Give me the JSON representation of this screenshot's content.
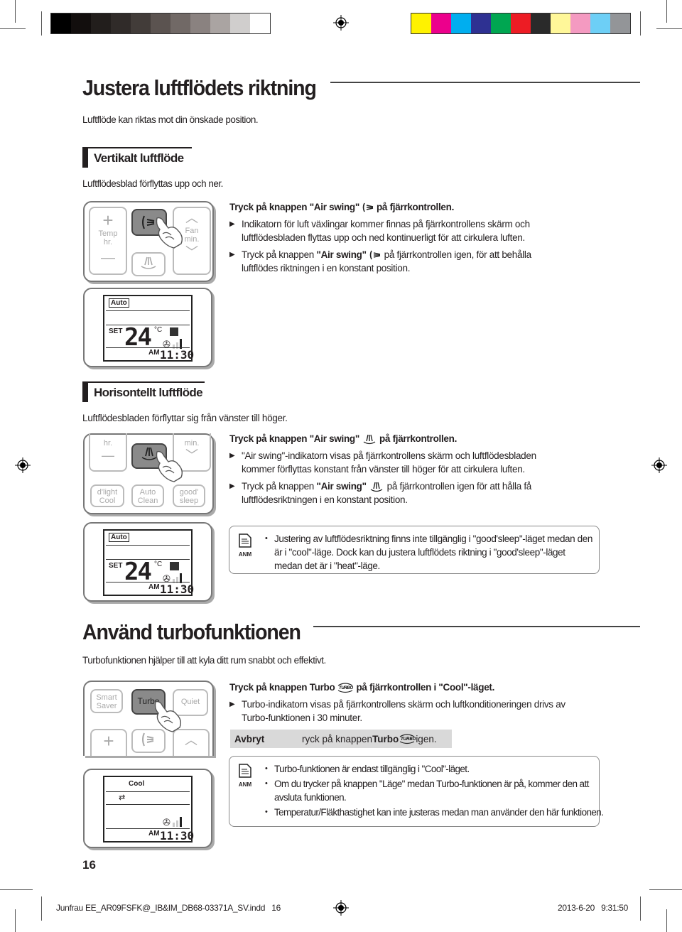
{
  "print_marks": {
    "gray_swatches": [
      "#000000",
      "#120e0d",
      "#221e1c",
      "#302b29",
      "#423c39",
      "#5b5350",
      "#716966",
      "#8a8280",
      "#aaa4a2",
      "#d0cecd",
      "#ffffff"
    ],
    "color_swatches": [
      "#fff200",
      "#ec008c",
      "#00aeef",
      "#2e3192",
      "#00a651",
      "#ed1c24",
      "#2a2a2a",
      "#fff799",
      "#f49ac1",
      "#6dcff6",
      "#939598"
    ]
  },
  "section1": {
    "title": "Justera luftflödets riktning",
    "intro": "Luftflöde kan riktas mot din önskade position.",
    "vertical": {
      "heading": "Vertikalt luftflöde",
      "subtitle": "Luftflödesblad förflyttas upp och ner.",
      "remote": {
        "left_labels": [
          "Temp",
          "hr."
        ],
        "right_labels": [
          "Fan",
          "min."
        ],
        "pressed_button_icon": "air-swing-vertical"
      },
      "lead_pre": "Tryck på knappen \"Air swing\"",
      "lead_post": "på fjärrkontrollen.",
      "bullet1": "Indikatorn för luft växlingar kommer finnas på fjärrkontrollens skärm och luftflödesbladen flyttas upp och ned kontinuerligt för att cirkulera luften.",
      "bullet2_pre": "Tryck på knappen ",
      "bullet2_bold": "\"Air swing\"",
      "bullet2_post": "på fjärrkontrollen igen, för att behålla luftflödes riktningen i en konstant position.",
      "lcd": {
        "mode": "Auto",
        "set_label": "SET",
        "temp": "24",
        "unit": "°C",
        "am": "AM",
        "time": "11:30"
      }
    },
    "horizontal": {
      "heading": "Horisontellt luftflöde",
      "subtitle": "Luftflödesbladen förflyttar sig från vänster till höger.",
      "remote": {
        "top_left": "hr.",
        "top_right": "min.",
        "bottom_buttons": [
          [
            "d'light",
            "Cool"
          ],
          [
            "Auto",
            "Clean"
          ],
          [
            "good'",
            "sleep"
          ]
        ],
        "pressed_button_icon": "air-swing-horizontal"
      },
      "lead_pre": "Tryck på knappen \"Air swing\"",
      "lead_post": "på fjärrkontrollen.",
      "bullet1": "\"Air swing\"-indikatorn visas på fjärrkontrollens skärm och luftflödesbladen kommer förflyttas konstant från vänster till höger för att cirkulera luften.",
      "bullet2_pre": "Tryck på knappen ",
      "bullet2_bold": "\"Air swing\"",
      "bullet2_post": "på fjärrkontrollen igen för att hålla få luftflödesriktningen i en konstant position.",
      "lcd": {
        "mode": "Auto",
        "set_label": "SET",
        "temp": "24",
        "unit": "°C",
        "am": "AM",
        "time": "11:30"
      },
      "note": {
        "label": "ANM",
        "items": [
          "Justering av luftflödesriktning finns inte tillgänglig i \"good'sleep\"-läget medan den är i \"cool\"-läge. Dock kan du justera luftflödets riktning i \"good'sleep\"-läget medan det är i \"heat\"-läge."
        ]
      }
    }
  },
  "section2": {
    "title": "Använd turbofunktionen",
    "intro": "Turbofunktionen hjälper till att kyla ditt rum snabbt och effektivt.",
    "remote": {
      "top_buttons": [
        [
          "Smart",
          "Saver"
        ],
        [
          "Turbo"
        ],
        [
          "Quiet"
        ]
      ],
      "pressed_button": "Turbo"
    },
    "lead_pre": "Tryck på knappen Turbo",
    "lead_post": "på fjärrkontrollen i \"Cool\"-läget.",
    "bullet1": "Turbo-indikatorn visas på fjärrkontrollens skärm och luftkonditioneringen drivs av Turbo-funktionen i 30 minuter.",
    "cancel": {
      "label": "Avbryt",
      "text_pre": "ryck på knappen ",
      "text_bold": "Turbo",
      "text_post": " igen."
    },
    "lcd": {
      "mode": "Cool",
      "am": "AM",
      "time": "11:30"
    },
    "note": {
      "label": "ANM",
      "items": [
        "Turbo-funktionen är endast tillgänglig i \"Cool\"-läget.",
        "Om du trycker på knappen \"Läge\" medan Turbo-funktionen är på, kommer den att avsluta funktionen.",
        "Temperatur/Fläkthastighet kan inte justeras medan man använder den här funktionen."
      ]
    }
  },
  "footer": {
    "page_number": "16",
    "slug_file": "Junfrau EE_AR09FSFK@_IB&IM_DB68-03371A_SV.indd   16",
    "slug_date": "2013-6-20   9:31:50"
  }
}
